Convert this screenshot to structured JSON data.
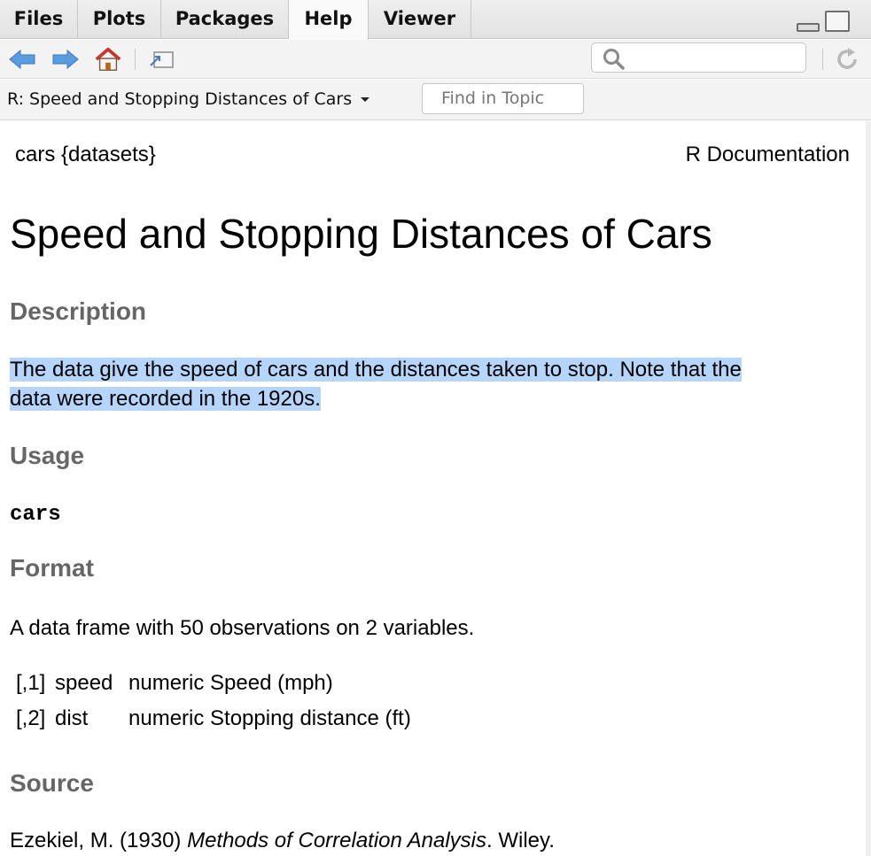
{
  "tabs": [
    {
      "label": "Files",
      "active": false
    },
    {
      "label": "Plots",
      "active": false
    },
    {
      "label": "Packages",
      "active": false
    },
    {
      "label": "Help",
      "active": true
    },
    {
      "label": "Viewer",
      "active": false
    }
  ],
  "toolbar": {
    "back_icon": "arrow-left-icon",
    "forward_icon": "arrow-right-icon",
    "home_icon": "home-icon",
    "popout_icon": "popout-window-icon",
    "search_placeholder": "",
    "refresh_icon": "refresh-icon"
  },
  "topic": {
    "title": "R: Speed and Stopping Distances of Cars",
    "find_placeholder": "Find in Topic"
  },
  "doc": {
    "package": "cars {datasets}",
    "source_label": "R Documentation",
    "title": "Speed and Stopping Distances of Cars",
    "description_heading": "Description",
    "description_line1": "The data give the speed of cars and the distances taken to stop. Note that the",
    "description_line2": "data were recorded in the 1920s.",
    "usage_heading": "Usage",
    "usage_code": "cars",
    "format_heading": "Format",
    "format_text": "A data frame with 50 observations on 2 variables.",
    "format_rows": [
      {
        "index": "[,1]",
        "name": "speed",
        "type": "numeric Speed (mph)"
      },
      {
        "index": "[,2]",
        "name": "dist",
        "type": "numeric Stopping distance (ft)"
      }
    ],
    "source_heading": "Source",
    "source_author": "Ezekiel, M. (1930)",
    "source_book": "Methods of Correlation Analysis",
    "source_publisher": ". Wiley."
  },
  "colors": {
    "selection": "#b5d5fc",
    "heading_gray": "#666666",
    "arrow_blue": "#4a90d9",
    "home_red": "#c0392b"
  }
}
